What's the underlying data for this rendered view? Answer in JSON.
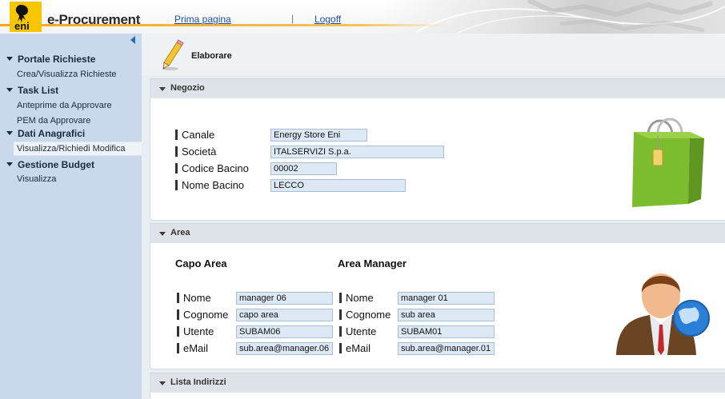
{
  "header": {
    "app_title": "e-Procurement",
    "logo_text": "eni",
    "links": {
      "home": "Prima pagina",
      "separator": "|",
      "logoff": "Logoff"
    }
  },
  "sidebar": {
    "groups": [
      {
        "label": "Portale Richieste",
        "items": [
          "Crea/Visualizza Richieste"
        ]
      },
      {
        "label": "Task List",
        "items": [
          "Anteprime da Approvare",
          "PEM da Approvare"
        ]
      },
      {
        "label": "Dati Anagrafici",
        "items": [
          "Visualizza/Richiedi Modifica"
        ]
      },
      {
        "label": "Gestione Budget",
        "items": [
          "Visualizza"
        ]
      }
    ],
    "selected_item": "Visualizza/Richiedi Modifica"
  },
  "page": {
    "title": "Elaborare"
  },
  "negozio": {
    "title": "Negozio",
    "fields": [
      {
        "label": "Canale",
        "value": "Energy Store Eni"
      },
      {
        "label": "Società",
        "value": "ITALSERVIZI S.p.a."
      },
      {
        "label": "Codice Bacino",
        "value": "00002"
      },
      {
        "label": "Nome Bacino",
        "value": "LECCO"
      }
    ]
  },
  "area": {
    "title": "Area",
    "capo_area": {
      "heading": "Capo Area",
      "fields": [
        {
          "label": "Nome",
          "value": "manager 06"
        },
        {
          "label": "Cognome",
          "value": "capo area"
        },
        {
          "label": "Utente",
          "value": "SUBAM06"
        },
        {
          "label": "eMail",
          "value": "sub.area@manager.06"
        }
      ]
    },
    "area_manager": {
      "heading": "Area Manager",
      "fields": [
        {
          "label": "Nome",
          "value": "manager 01"
        },
        {
          "label": "Cognome",
          "value": "sub area"
        },
        {
          "label": "Utente",
          "value": "SUBAM01"
        },
        {
          "label": "eMail",
          "value": "sub.area@manager.01"
        }
      ]
    }
  },
  "lista_indirizzi": {
    "title": "Lista Indirizzi"
  },
  "icons": {
    "logo": "eni-logo-icon",
    "collapse": "collapse-left-icon",
    "edit": "pencil-icon",
    "shop": "shopping-bag-icon",
    "user": "user-globe-icon"
  },
  "colors": {
    "sidebar": "#c9d9eb",
    "link": "#1d4fa0",
    "accent": "#f5a623",
    "field": "#dde8f5"
  }
}
